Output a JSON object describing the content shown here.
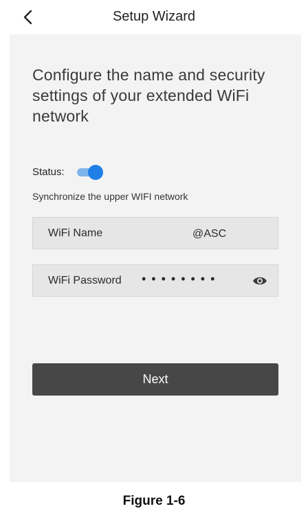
{
  "header": {
    "back_icon": "chevron-left-icon",
    "title": "Setup Wizard"
  },
  "main": {
    "heading": "Configure the name and security settings of your extended WiFi network",
    "status": {
      "label": "Status:",
      "enabled": true,
      "accent_color": "#1f7fe6"
    },
    "sync_text": "Synchronize the upper WIFI network",
    "wifi_name": {
      "label": "WiFi Name",
      "value": "@ASC"
    },
    "wifi_password": {
      "label": "WiFi Password",
      "masked_value": "••••••••",
      "toggle_icon": "eye-icon"
    },
    "next_button": {
      "label": "Next",
      "color": "#474747"
    }
  },
  "caption": "Figure 1-6"
}
